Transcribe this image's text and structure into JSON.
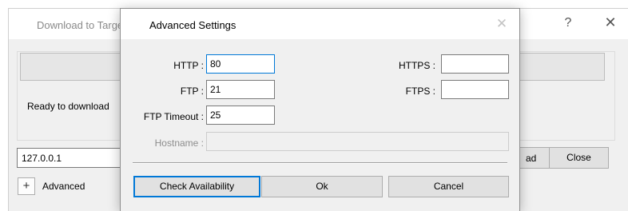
{
  "background_window": {
    "title": "Download to Target",
    "help_glyph": "?",
    "close_glyph": "✕",
    "status_text": "Ready to download",
    "ip_value": "127.0.0.1",
    "download_button_partial": "ad",
    "close_button_label": "Close",
    "advanced_toggle_glyph": "+",
    "advanced_label": "Advanced"
  },
  "dialog": {
    "title": "Advanced Settings",
    "close_glyph": "✕",
    "fields": {
      "http_label": "HTTP :",
      "http_value": "80",
      "ftp_label": "FTP :",
      "ftp_value": "21",
      "ftp_timeout_label": "FTP Timeout :",
      "ftp_timeout_value": "25",
      "hostname_label": "Hostname :",
      "hostname_value": "",
      "https_label": "HTTPS :",
      "https_value": "",
      "ftps_label": "FTPS :",
      "ftps_value": ""
    },
    "buttons": {
      "check_availability": "Check Availability",
      "ok": "Ok",
      "cancel": "Cancel"
    }
  },
  "colors": {
    "accent": "#0078d7",
    "window_background": "#f0f0f0",
    "button_face": "#e1e1e1"
  }
}
